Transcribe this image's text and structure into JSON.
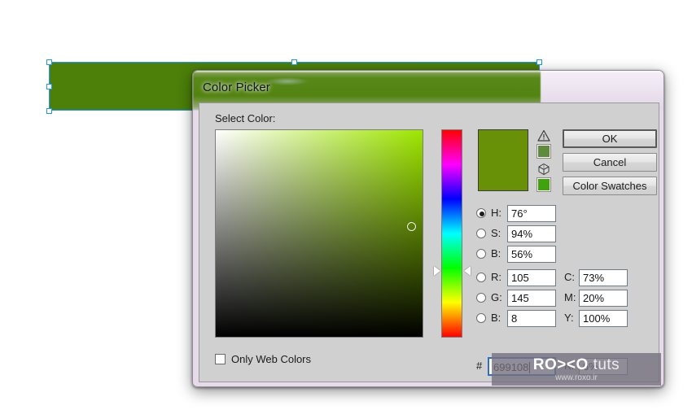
{
  "canvas": {
    "shape": {
      "name": "green-rectangle",
      "fill": "#4c8009"
    },
    "selection": {
      "outline_color": "#2196f3",
      "handle_fill": "#ffffff"
    }
  },
  "dialog": {
    "title": "Color Picker",
    "section_label": "Select Color:",
    "buttons": {
      "ok": "OK",
      "cancel": "Cancel",
      "swatches": "Color Swatches"
    },
    "preview_color": "#699108",
    "out_of_gamut_swatch": "#5f8c3c",
    "web_safe_swatch": "#41a30c",
    "icons": {
      "gamut_warning": "warning-triangle-icon",
      "web_safe": "cube-icon"
    },
    "color_model": {
      "selected_channel": "H",
      "fields": [
        {
          "key": "H",
          "label": "H:",
          "value": "76°",
          "selected": true
        },
        {
          "key": "S",
          "label": "S:",
          "value": "94%",
          "selected": false
        },
        {
          "key": "B",
          "label": "B:",
          "value": "56%",
          "selected": false
        },
        {
          "key": "R",
          "label": "R:",
          "value": "105",
          "selected": false
        },
        {
          "key": "G",
          "label": "G:",
          "value": "145",
          "selected": false
        },
        {
          "key": "B2",
          "label": "B:",
          "value": "8",
          "selected": false
        }
      ],
      "cmyk": [
        {
          "key": "C",
          "label": "C:",
          "value": "73%"
        },
        {
          "key": "M",
          "label": "M:",
          "value": "20%"
        },
        {
          "key": "Y",
          "label": "Y:",
          "value": "100%"
        },
        {
          "key": "K",
          "label": "K:",
          "value": "6%"
        }
      ],
      "hex": {
        "label": "#",
        "value": "699108"
      }
    },
    "only_web_colors": {
      "label": "Only Web Colors",
      "checked": false
    }
  },
  "watermark": {
    "brand_bold": "RO><O",
    "brand_light": "tuts",
    "url": "www.roxo.ir"
  }
}
